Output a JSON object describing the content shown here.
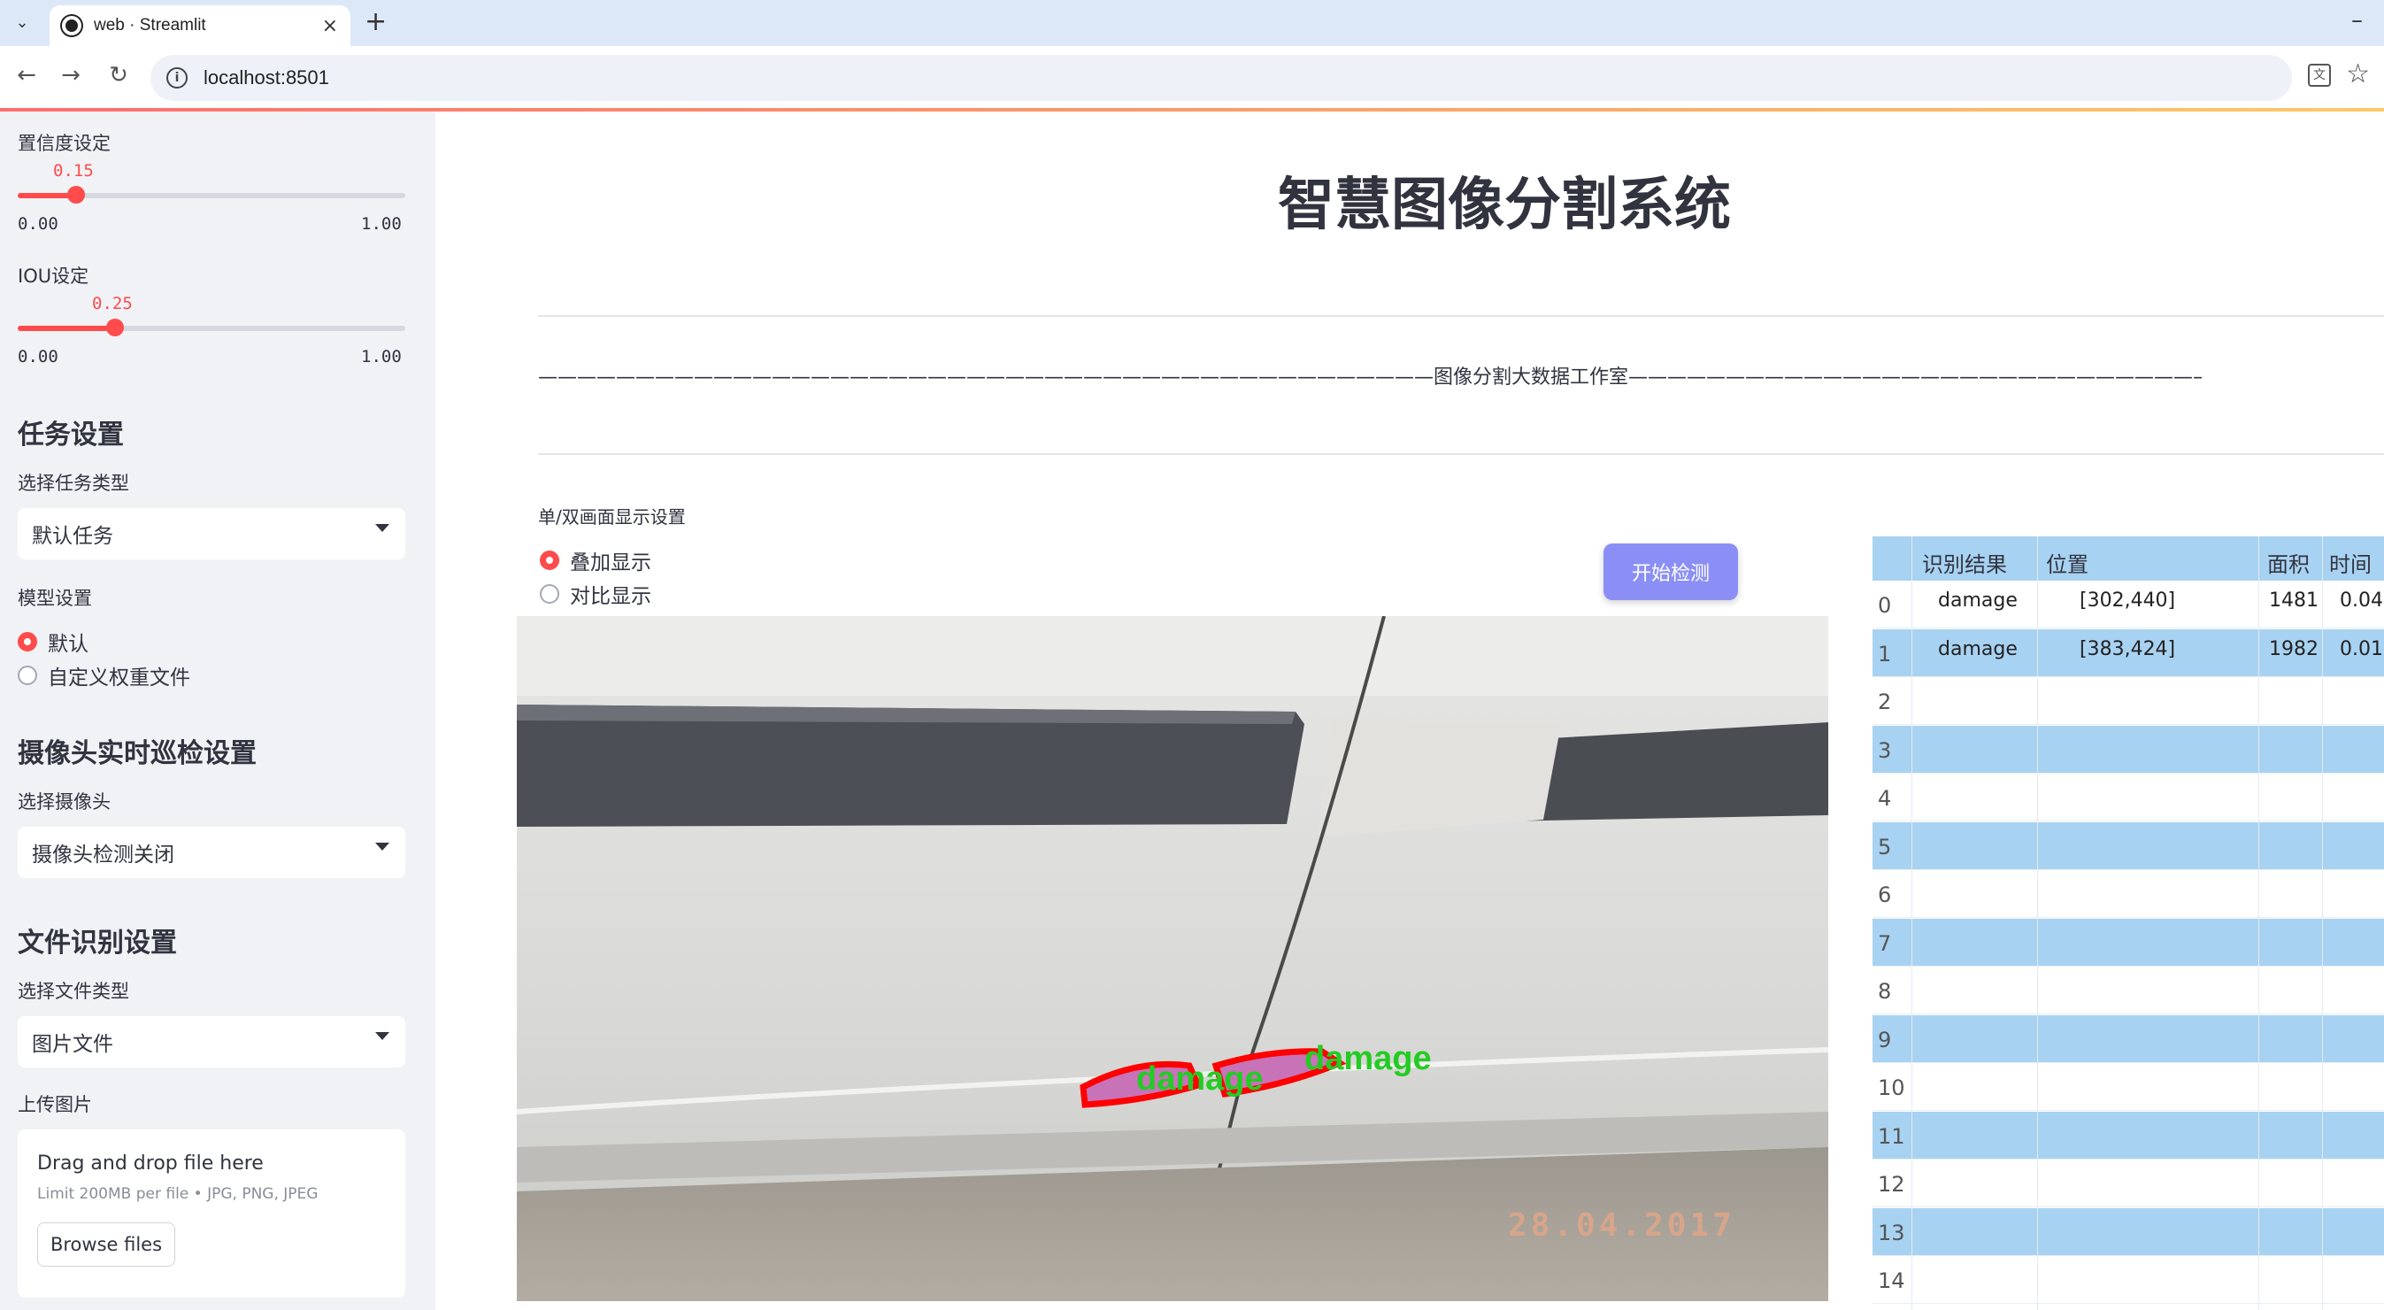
{
  "browser": {
    "tab_title": "web · Streamlit",
    "url": "localhost:8501"
  },
  "sidebar": {
    "confidence": {
      "label": "置信度设定",
      "value": "0.15",
      "value_fraction": 0.15,
      "min": "0.00",
      "max": "1.00"
    },
    "iou": {
      "label": "IOU设定",
      "value": "0.25",
      "value_fraction": 0.25,
      "min": "0.00",
      "max": "1.00"
    },
    "task": {
      "section": "任务设置",
      "label": "选择任务类型",
      "selected": "默认任务"
    },
    "model": {
      "label": "模型设置",
      "options": [
        "默认",
        "自定义权重文件"
      ],
      "selected_index": 0
    },
    "camera": {
      "section": "摄像头实时巡检设置",
      "label": "选择摄像头",
      "selected": "摄像头检测关闭"
    },
    "file": {
      "section": "文件识别设置",
      "label": "选择文件类型",
      "selected": "图片文件"
    },
    "upload": {
      "label": "上传图片",
      "drag_text": "Drag and drop file here",
      "limit_text": "Limit 200MB per file • JPG, PNG, JPEG",
      "browse_label": "Browse files"
    }
  },
  "main": {
    "title": "智慧图像分割系统",
    "studio_line": "——————————————————————————————————————————————图像分割大数据工作室——————————————————————————————————————————————",
    "display_mode_label": "单/双画面显示设置",
    "display_options": [
      "叠加显示",
      "对比显示"
    ],
    "display_selected_index": 0,
    "start_button": "开始检测",
    "image": {
      "date_stamp": "28.04.2017",
      "detections": [
        "damage",
        "damage"
      ]
    }
  },
  "results_table": {
    "headers": [
      "识别结果",
      "位置",
      "面积",
      "时间"
    ],
    "rows": [
      {
        "idx": "0",
        "result": "damage",
        "position": "[302,440]",
        "area": "1481",
        "time": "0.04"
      },
      {
        "idx": "1",
        "result": "damage",
        "position": "[383,424]",
        "area": "1982",
        "time": "0.01"
      },
      {
        "idx": "2",
        "result": "",
        "position": "",
        "area": "",
        "time": ""
      },
      {
        "idx": "3",
        "result": "",
        "position": "",
        "area": "",
        "time": ""
      },
      {
        "idx": "4",
        "result": "",
        "position": "",
        "area": "",
        "time": ""
      },
      {
        "idx": "5",
        "result": "",
        "position": "",
        "area": "",
        "time": ""
      },
      {
        "idx": "6",
        "result": "",
        "position": "",
        "area": "",
        "time": ""
      },
      {
        "idx": "7",
        "result": "",
        "position": "",
        "area": "",
        "time": ""
      },
      {
        "idx": "8",
        "result": "",
        "position": "",
        "area": "",
        "time": ""
      },
      {
        "idx": "9",
        "result": "",
        "position": "",
        "area": "",
        "time": ""
      },
      {
        "idx": "10",
        "result": "",
        "position": "",
        "area": "",
        "time": ""
      },
      {
        "idx": "11",
        "result": "",
        "position": "",
        "area": "",
        "time": ""
      },
      {
        "idx": "12",
        "result": "",
        "position": "",
        "area": "",
        "time": ""
      },
      {
        "idx": "13",
        "result": "",
        "position": "",
        "area": "",
        "time": ""
      },
      {
        "idx": "14",
        "result": "",
        "position": "",
        "area": "",
        "time": ""
      }
    ]
  },
  "colors": {
    "accent": "#ff4b4b",
    "button": "#8b8ff5",
    "table_stripe": "#a8d2f2",
    "sidebar_bg": "#f0f2f6"
  }
}
